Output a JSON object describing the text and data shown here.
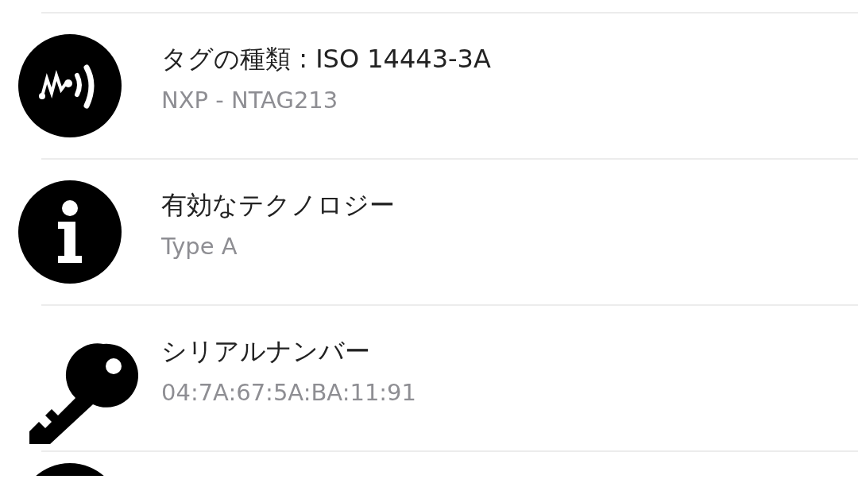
{
  "items": [
    {
      "kind": "tag",
      "title": "タグの種類 : ISO 14443-3A",
      "subtitle": "NXP - NTAG213"
    },
    {
      "kind": "info",
      "title": "有効なテクノロジー",
      "subtitle": "Type A"
    },
    {
      "kind": "key",
      "title": "シリアルナンバー",
      "subtitle": "04:7A:67:5A:BA:11:91"
    },
    {
      "kind": "disc"
    }
  ]
}
